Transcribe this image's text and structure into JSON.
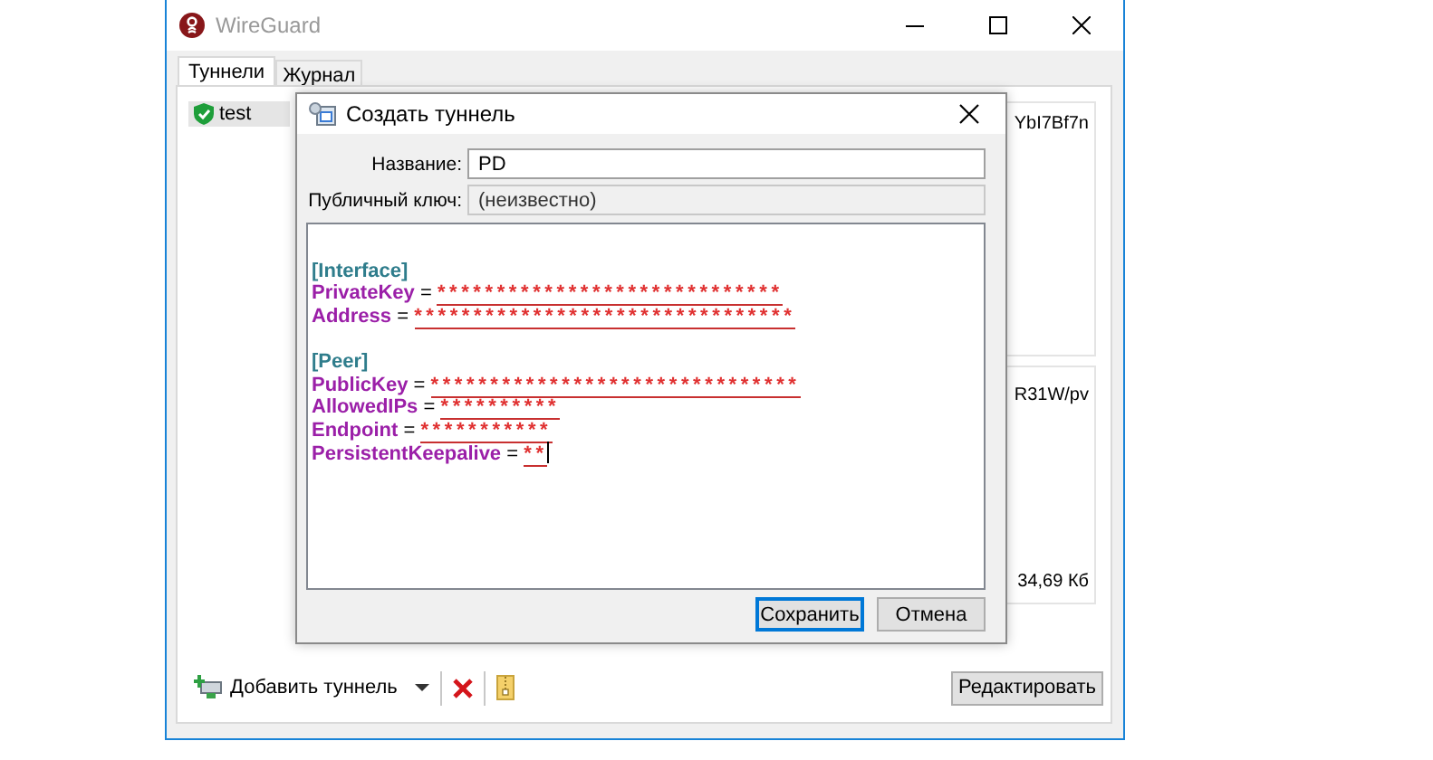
{
  "window": {
    "title": "WireGuard"
  },
  "tabs": [
    {
      "label": "Туннели",
      "selected": true
    },
    {
      "label": "Журнал",
      "selected": false
    }
  ],
  "tunnels": [
    {
      "name": "test",
      "selected": true,
      "active": true
    }
  ],
  "details_fragments": [
    {
      "text": "YbI7Bf7n"
    },
    {
      "text": "R31W/pv"
    },
    {
      "text": "34,69 Кб"
    }
  ],
  "toolbar": {
    "add_label": "Добавить туннель"
  },
  "edit_button": "Редактировать",
  "dialog": {
    "title": "Создать туннель",
    "fields": [
      {
        "label": "Название:",
        "value": "PD",
        "readonly": false
      },
      {
        "label": "Публичный ключ:",
        "value": "(неизвестно)",
        "readonly": true
      }
    ],
    "config": [
      {
        "kind": "blank"
      },
      {
        "kind": "section",
        "text": "[Interface]"
      },
      {
        "kind": "pair",
        "key": "PrivateKey",
        "sep": "=",
        "value": "*****************************"
      },
      {
        "kind": "pair",
        "key": "Address",
        "sep": "=",
        "value": "********************************"
      },
      {
        "kind": "blank"
      },
      {
        "kind": "section",
        "text": "[Peer]"
      },
      {
        "kind": "pair",
        "key": "PublicKey",
        "sep": "=",
        "value": "*******************************"
      },
      {
        "kind": "pair",
        "key": "AllowedIPs",
        "sep": "=",
        "value": "**********"
      },
      {
        "kind": "pair",
        "key": "Endpoint",
        "sep": "=",
        "value": "***********"
      },
      {
        "kind": "pair",
        "key": "PersistentKeepalive",
        "sep": "=",
        "value": "**"
      }
    ],
    "buttons": [
      {
        "label": "Сохранить",
        "default": true
      },
      {
        "label": "Отмена",
        "default": false
      }
    ]
  }
}
